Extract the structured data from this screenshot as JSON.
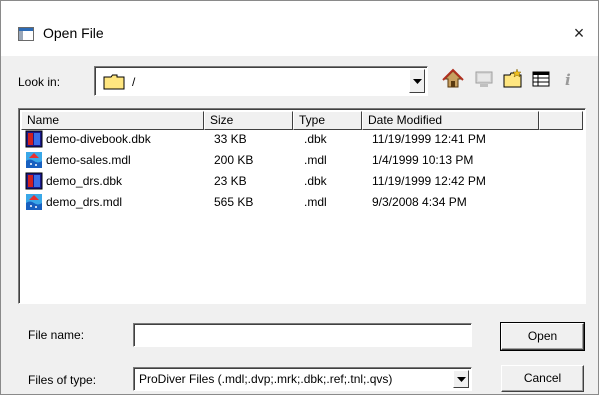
{
  "window": {
    "title": "Open File",
    "close": "×"
  },
  "lookin": {
    "label": "Look in:",
    "value": "/"
  },
  "toolbar": {
    "icons": [
      "up-folder-icon",
      "desktop-icon",
      "new-folder-icon",
      "details-view-icon",
      "info-icon"
    ]
  },
  "columns": [
    "Name",
    "Size",
    "Type",
    "Date Modified"
  ],
  "files": [
    {
      "name": "demo-divebook.dbk",
      "size": "33 KB",
      "type": ".dbk",
      "modified": "11/19/1999 12:41 PM",
      "icon": "divebook-icon"
    },
    {
      "name": "demo-sales.mdl",
      "size": "200 KB",
      "type": ".mdl",
      "modified": "1/4/1999 10:13 PM",
      "icon": "model-icon"
    },
    {
      "name": "demo_drs.dbk",
      "size": "23 KB",
      "type": ".dbk",
      "modified": "11/19/1999 12:42 PM",
      "icon": "divebook-icon"
    },
    {
      "name": "demo_drs.mdl",
      "size": "565 KB",
      "type": ".mdl",
      "modified": "9/3/2008 4:34 PM",
      "icon": "model-icon"
    }
  ],
  "filename": {
    "label": "File name:",
    "value": ""
  },
  "filetype": {
    "label": "Files of type:",
    "value": "ProDiver Files (.mdl;.dvp;.mrk;.dbk;.ref;.tnl;.qvs)"
  },
  "buttons": {
    "open": "Open",
    "cancel": "Cancel"
  }
}
